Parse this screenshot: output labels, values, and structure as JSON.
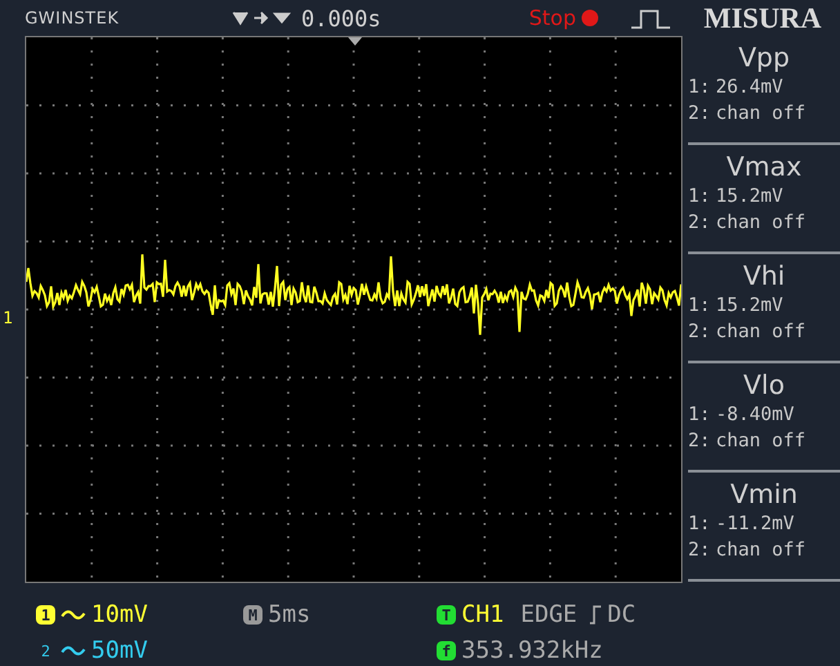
{
  "top_bar": {
    "brand": "GWINSTEK",
    "time_offset": "0.000s",
    "run_state": "Stop",
    "title": "MISURA"
  },
  "plot": {
    "channel_marker": "1"
  },
  "measurements": [
    {
      "name": "Vpp",
      "readings": [
        {
          "channel": "1:",
          "value": "26.4mV"
        },
        {
          "channel": "2:",
          "value": "chan off"
        }
      ]
    },
    {
      "name": "Vmax",
      "readings": [
        {
          "channel": "1:",
          "value": "15.2mV"
        },
        {
          "channel": "2:",
          "value": "chan off"
        }
      ]
    },
    {
      "name": "Vhi",
      "readings": [
        {
          "channel": "1:",
          "value": "15.2mV"
        },
        {
          "channel": "2:",
          "value": "chan off"
        }
      ]
    },
    {
      "name": "Vlo",
      "readings": [
        {
          "channel": "1:",
          "value": "-8.40mV"
        },
        {
          "channel": "2:",
          "value": "chan off"
        }
      ]
    },
    {
      "name": "Vmin",
      "readings": [
        {
          "channel": "1:",
          "value": "-11.2mV"
        },
        {
          "channel": "2:",
          "value": "chan off"
        }
      ]
    }
  ],
  "bottom_bar": {
    "channels": [
      {
        "badge": "1",
        "scale": "10mV",
        "color": "#ffff33"
      },
      {
        "badge": "2",
        "scale": "50mV",
        "color": "#33ccee"
      }
    ],
    "timebase": {
      "badge": "M",
      "value": "5ms"
    },
    "trigger": {
      "badge": "T",
      "source": "CH1",
      "type": "EDGE",
      "coupling": "DC"
    },
    "frequency": {
      "badge": "f",
      "value": "353.932kHz"
    }
  }
}
